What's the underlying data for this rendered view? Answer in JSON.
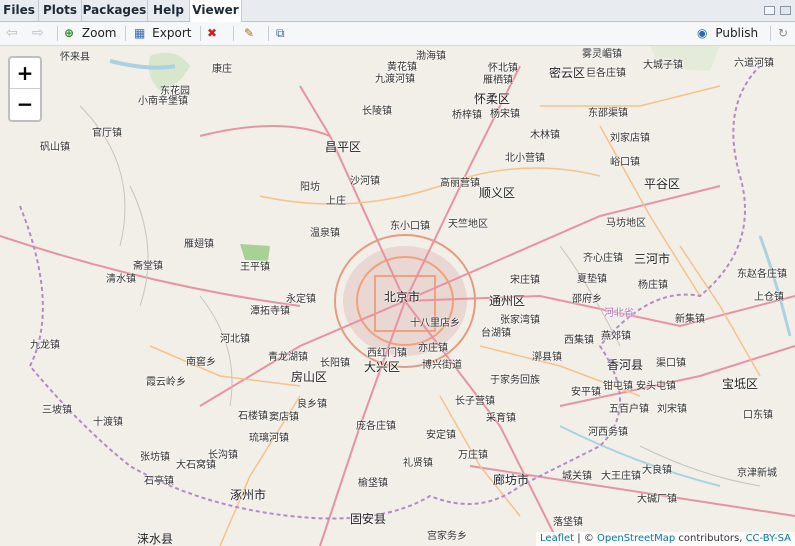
{
  "tabs": [
    {
      "label": "Files"
    },
    {
      "label": "Plots"
    },
    {
      "label": "Packages"
    },
    {
      "label": "Help"
    },
    {
      "label": "Viewer"
    }
  ],
  "toolbar": {
    "zoom_label": "Zoom",
    "export_label": "Export",
    "publish_label": "Publish"
  },
  "map": {
    "zoom_in": "+",
    "zoom_out": "−",
    "labels": [
      "怀来县",
      "康庄",
      "东花园",
      "小南辛堡镇",
      "官厅镇",
      "矾山镇",
      "黄花镇",
      "九渡河镇",
      "渤海镇",
      "怀北镇",
      "雁栖镇",
      "怀柔区",
      "杨宋镇",
      "桥梓镇",
      "雾灵嵋镇",
      "密云区",
      "巨各庄镇",
      "大城子镇",
      "六道河镇",
      "东邵渠镇",
      "长陵镇",
      "木林镇",
      "刘家店镇",
      "北小营镇",
      "峪口镇",
      "昌平区",
      "沙河镇",
      "阳坊",
      "高丽营镇",
      "顺义区",
      "平谷区",
      "上庄",
      "马坊地区",
      "东小口镇",
      "天竺地区",
      "温泉镇",
      "齐心庄镇",
      "三河市",
      "雁翅镇",
      "宋庄镇",
      "夏垫镇",
      "杨庄镇",
      "斋堂镇",
      "王平镇",
      "东赵各庄镇",
      "清水镇",
      "北京市",
      "永定镇",
      "通州区",
      "邵府乡",
      "上仓镇",
      "潭拓寺镇",
      "十八里店乡",
      "张家湾镇",
      "河北省",
      "新集镇",
      "河北镇",
      "台湖镇",
      "燕郊镇",
      "西集镇",
      "九龙镇",
      "青龙湖镇",
      "长阳镇",
      "西红门镇",
      "亦庄镇",
      "漷县镇",
      "香河县",
      "渠口镇",
      "南窖乡",
      "大兴区",
      "博兴街道",
      "房山区",
      "于家务回族",
      "安平镇",
      "钳屯镇",
      "安头屯镇",
      "宝坻区",
      "霞云岭乡",
      "良乡镇",
      "长子营镇",
      "五百户镇",
      "刘宋镇",
      "三坡镇",
      "十渡镇",
      "石楼镇",
      "窦店镇",
      "庞各庄镇",
      "采育镇",
      "口东镇",
      "琉璃河镇",
      "安定镇",
      "河西务镇",
      "张坊镇",
      "长沟镇",
      "万庄镇",
      "大良镇",
      "京津新城",
      "大石窝镇",
      "石亭镇",
      "礼贤镇",
      "城关镇",
      "大王庄镇",
      "涿州市",
      "榆垡镇",
      "廊坊市",
      "大碱厂镇",
      "涞水县",
      "固安县",
      "落垡镇",
      "宫家务乡"
    ]
  },
  "attribution": {
    "leaflet": "Leaflet",
    "sep": " | © ",
    "osm": "OpenStreetMap",
    "contrib": " contributors, ",
    "license": "CC-BY-SA"
  }
}
